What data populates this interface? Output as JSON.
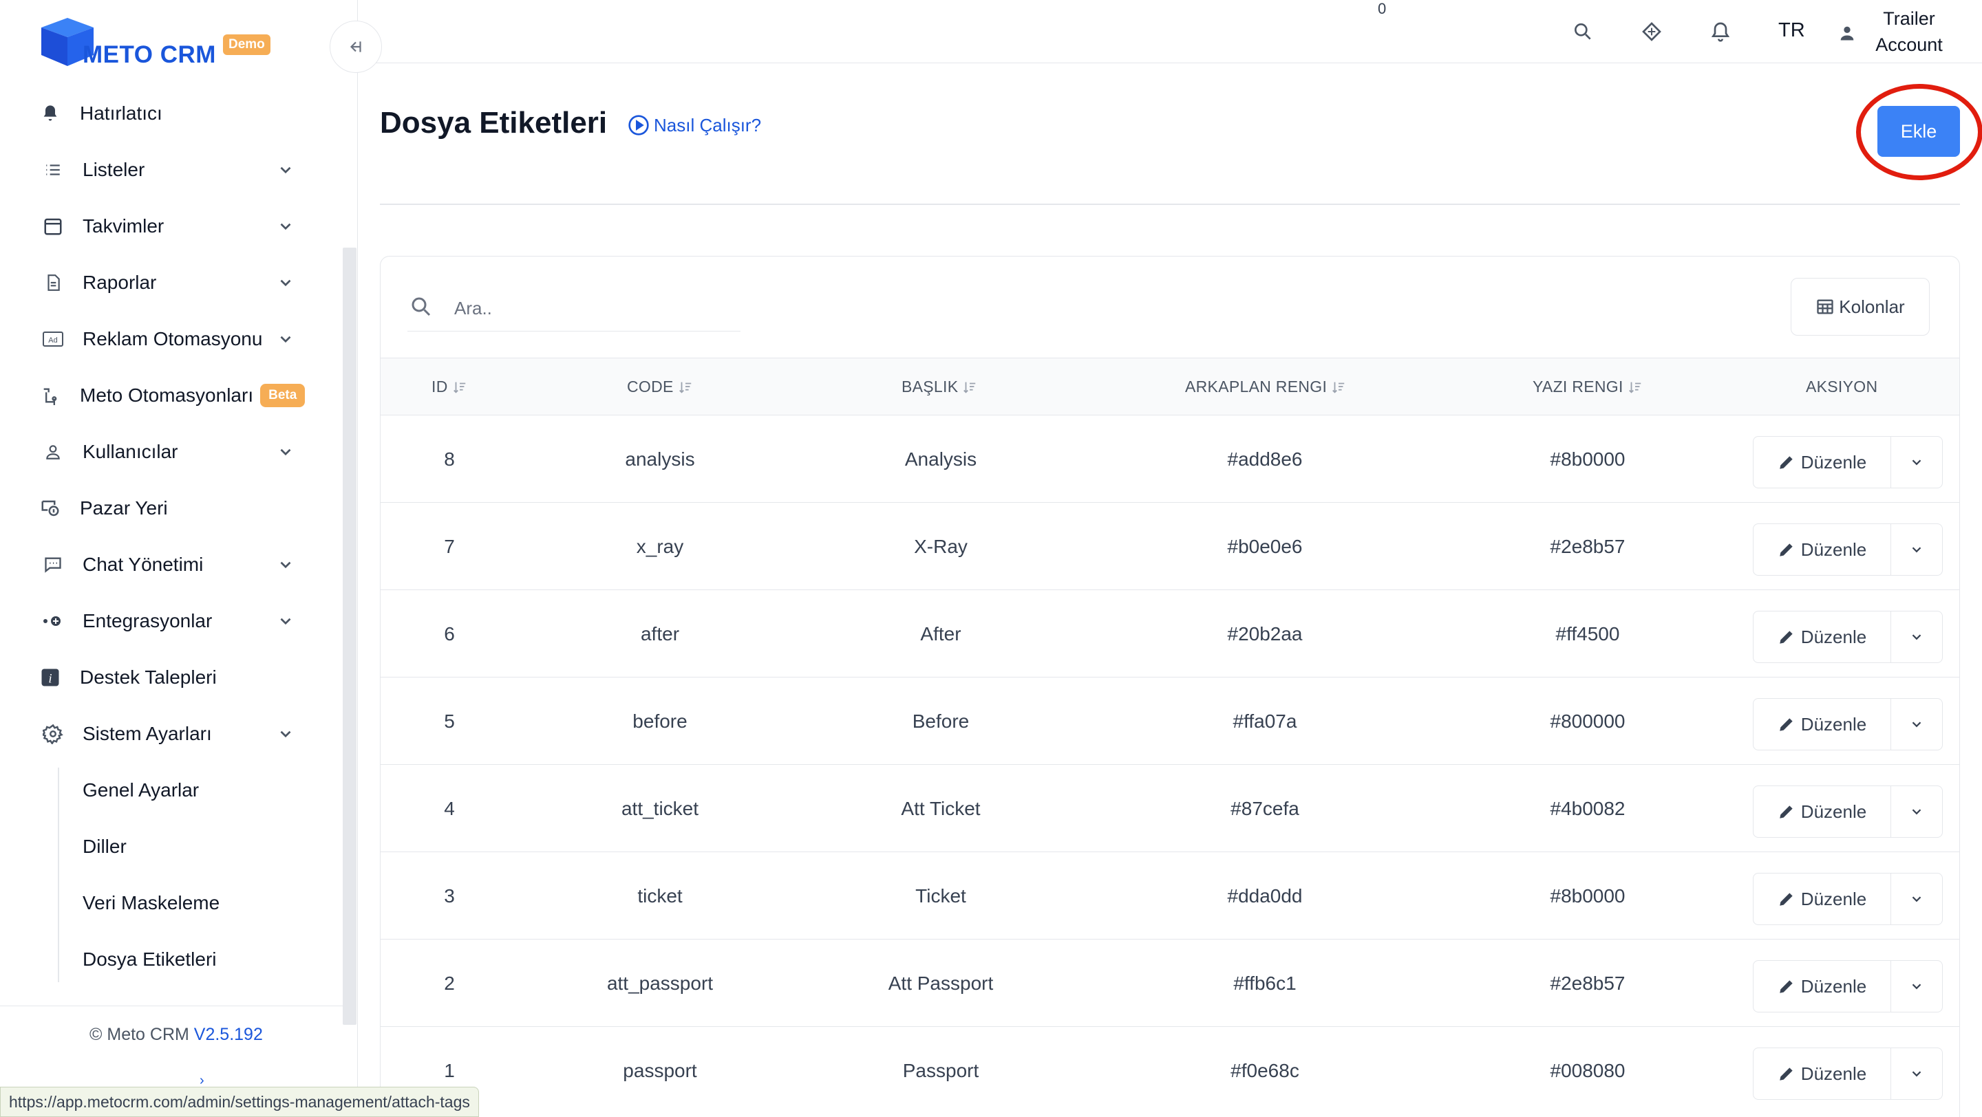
{
  "brand": {
    "name": "METO CRM",
    "badge": "Demo"
  },
  "sidebar": {
    "items": [
      {
        "label": "Hatırlatıcı",
        "icon": "bell-icon",
        "expandable": false
      },
      {
        "label": "Listeler",
        "icon": "list-icon",
        "expandable": true
      },
      {
        "label": "Takvimler",
        "icon": "calendar-icon",
        "expandable": true
      },
      {
        "label": "Raporlar",
        "icon": "report-icon",
        "expandable": true
      },
      {
        "label": "Reklam Otomasyonu",
        "icon": "ad-icon",
        "expandable": true
      },
      {
        "label": "Meto Otomasyonları",
        "icon": "automation-icon",
        "expandable": false,
        "badge": "Beta"
      },
      {
        "label": "Kullanıcılar",
        "icon": "user-icon",
        "expandable": true
      },
      {
        "label": "Pazar Yeri",
        "icon": "marketplace-icon",
        "expandable": false
      },
      {
        "label": "Chat Yönetimi",
        "icon": "chat-icon",
        "expandable": true
      },
      {
        "label": "Entegrasyonlar",
        "icon": "integration-icon",
        "expandable": true
      },
      {
        "label": "Destek Talepleri",
        "icon": "info-icon",
        "expandable": false
      },
      {
        "label": "Sistem Ayarları",
        "icon": "gear-icon",
        "expandable": true
      }
    ],
    "sub_items": [
      {
        "label": "Genel Ayarlar"
      },
      {
        "label": "Diller"
      },
      {
        "label": "Veri Maskeleme"
      },
      {
        "label": "Dosya Etiketleri"
      }
    ],
    "footer": {
      "copyright": "© Meto CRM",
      "version": "V2.5.192"
    }
  },
  "topbar": {
    "notification_count": "0",
    "language": "TR",
    "account_line1": "Trailer",
    "account_line2": "Account"
  },
  "page": {
    "title": "Dosya Etiketleri",
    "how_it_works": "Nasıl Çalışır?",
    "add_button": "Ekle"
  },
  "table": {
    "search_placeholder": "Ara..",
    "columns_button": "Kolonlar",
    "headers": [
      "ID",
      "CODE",
      "BAŞLIK",
      "ARKAPLAN RENGI",
      "YAZI RENGI",
      "AKSIYON"
    ],
    "edit_label": "Düzenle",
    "rows": [
      {
        "id": "8",
        "code": "analysis",
        "title": "Analysis",
        "bg": "#add8e6",
        "fg": "#8b0000"
      },
      {
        "id": "7",
        "code": "x_ray",
        "title": "X-Ray",
        "bg": "#b0e0e6",
        "fg": "#2e8b57"
      },
      {
        "id": "6",
        "code": "after",
        "title": "After",
        "bg": "#20b2aa",
        "fg": "#ff4500"
      },
      {
        "id": "5",
        "code": "before",
        "title": "Before",
        "bg": "#ffa07a",
        "fg": "#800000"
      },
      {
        "id": "4",
        "code": "att_ticket",
        "title": "Att Ticket",
        "bg": "#87cefa",
        "fg": "#4b0082"
      },
      {
        "id": "3",
        "code": "ticket",
        "title": "Ticket",
        "bg": "#dda0dd",
        "fg": "#8b0000"
      },
      {
        "id": "2",
        "code": "att_passport",
        "title": "Att Passport",
        "bg": "#ffb6c1",
        "fg": "#2e8b57"
      },
      {
        "id": "1",
        "code": "passport",
        "title": "Passport",
        "bg": "#f0e68c",
        "fg": "#008080"
      }
    ]
  },
  "status_url": "https://app.metocrm.com/admin/settings-management/attach-tags",
  "colors": {
    "accent": "#3b82f6",
    "brand": "#1a56db",
    "badge": "#f6ad55",
    "highlight": "#e11d0e"
  }
}
